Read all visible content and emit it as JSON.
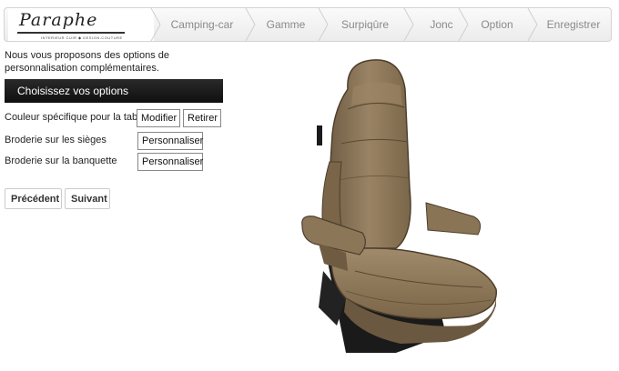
{
  "brand": {
    "name": "Paraphe",
    "tagline": "INTERIEUR CUIR ◆ DESIGN-COUTURE"
  },
  "steps": [
    "Camping-car",
    "Gamme",
    "Surpiqûre",
    "Jonc",
    "Option",
    "Enregistrer"
  ],
  "intro": {
    "line1": "Nous vous proposons des options de",
    "line2": "personnalisation complémentaires."
  },
  "section_title": "Choisissez vos options",
  "options": [
    {
      "label": "Couleur spécifique pour la table",
      "buttons": [
        "Modifier",
        "Retirer"
      ]
    },
    {
      "label": "Broderie sur les sièges",
      "buttons": [
        "Personnaliser"
      ]
    },
    {
      "label": "Broderie sur la banquette",
      "buttons": [
        "Personnaliser"
      ]
    }
  ],
  "nav": {
    "previous": "Précédent",
    "next": "Suivant"
  },
  "colors": {
    "leather": "#8b7558",
    "leather_dark": "#5e4c36",
    "leather_light": "#a68f70",
    "frame": "#1a1a1a",
    "section_bar": "#1a1a1a",
    "step_text": "#8a8a8a"
  },
  "seat_image": {
    "icon": "seat-image"
  }
}
